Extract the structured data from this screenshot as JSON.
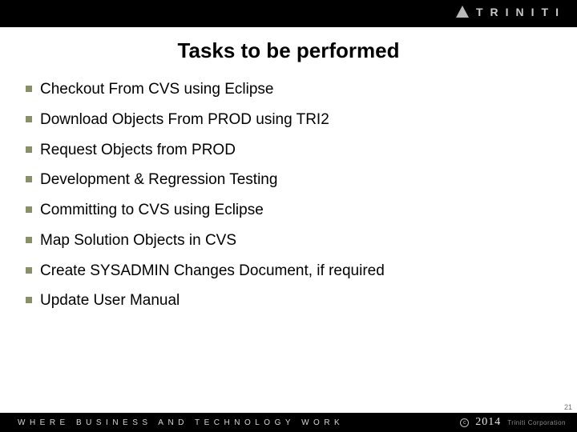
{
  "brand": {
    "name": "TRINITI"
  },
  "title": "Tasks to be performed",
  "tasks": [
    {
      "text": "Checkout From CVS using Eclipse"
    },
    {
      "text": "Download Objects From PROD using TRI2"
    },
    {
      "text": "Request Objects from PROD"
    },
    {
      "text": "Development & Regression Testing"
    },
    {
      "text": "Committing to CVS using Eclipse"
    },
    {
      "text": "Map Solution Objects in CVS"
    },
    {
      "text": "Create SYSADMIN Changes Document, if required"
    },
    {
      "text": "Update User Manual"
    }
  ],
  "footer": {
    "tagline": "WHERE BUSINESS AND TECHNOLOGY WORK",
    "year": "2014",
    "corp": "Triniti Corporation"
  },
  "page_number": "21"
}
